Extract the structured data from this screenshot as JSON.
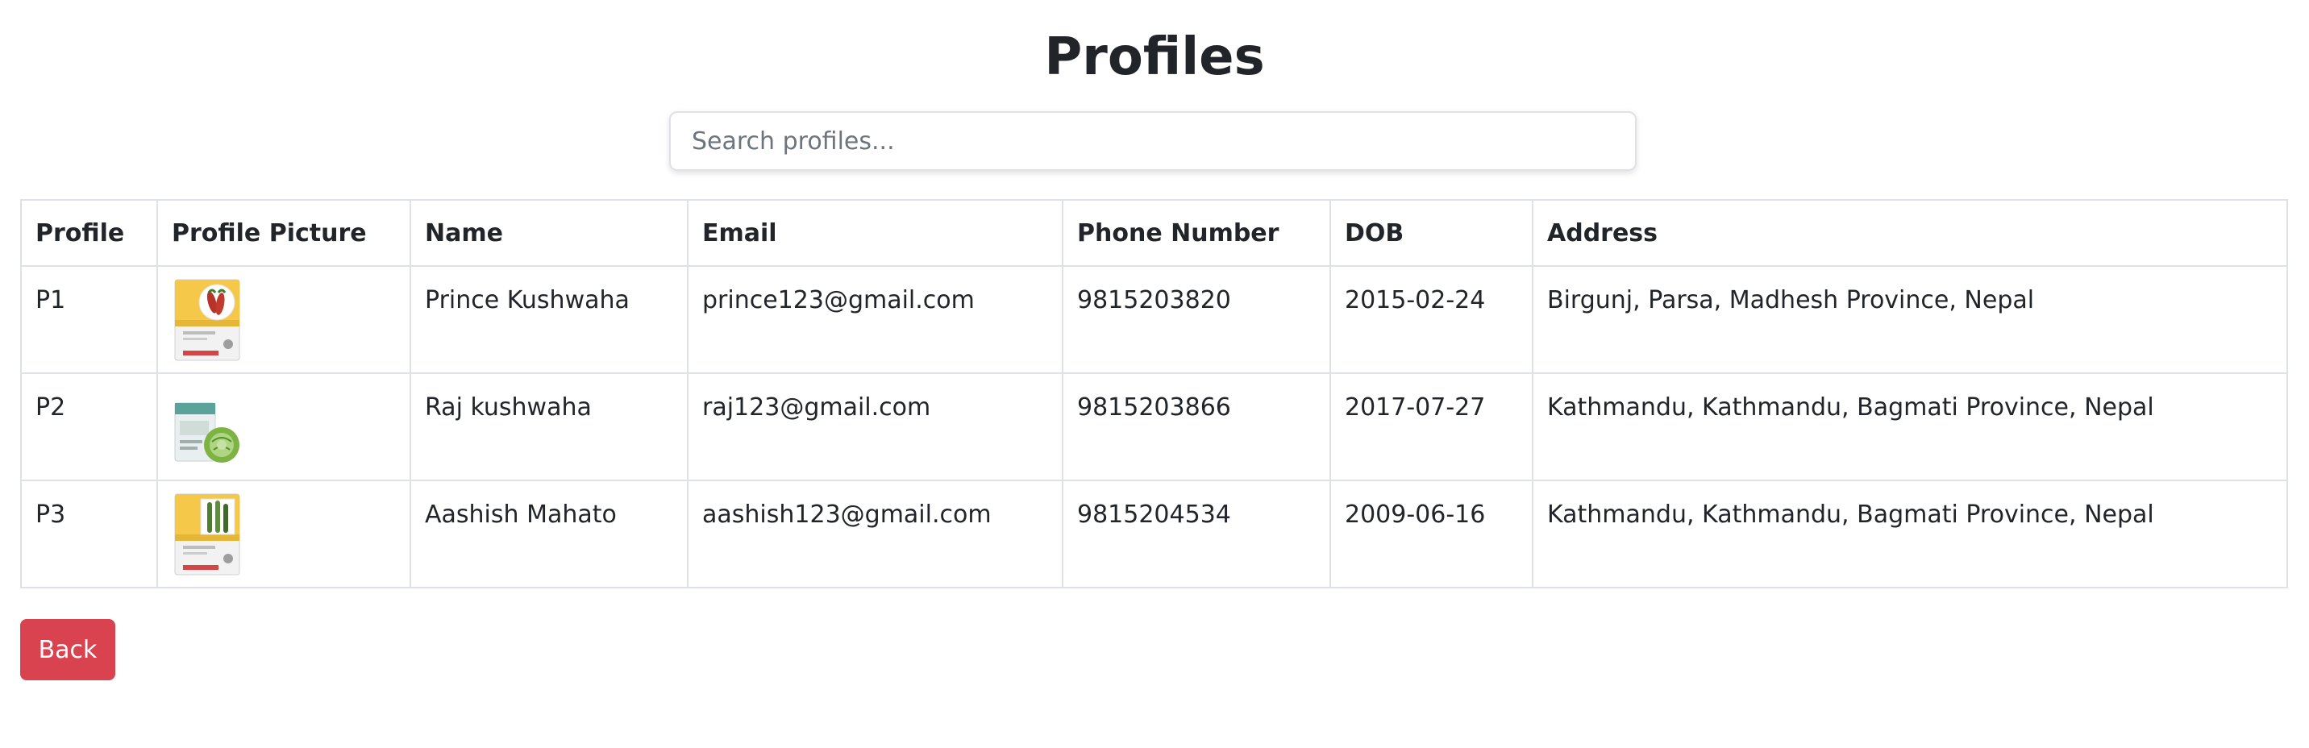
{
  "page": {
    "title": "Profiles"
  },
  "search": {
    "placeholder": "Search profiles..."
  },
  "table": {
    "headers": {
      "profile": "Profile",
      "picture": "Profile Picture",
      "name": "Name",
      "email": "Email",
      "phone": "Phone Number",
      "dob": "DOB",
      "address": "Address"
    },
    "rows": [
      {
        "profile": "P1",
        "picture_icon": "seed-packet-red-thumbnail",
        "name": "Prince Kushwaha",
        "email": "prince123@gmail.com",
        "phone": "9815203820",
        "dob": "2015-02-24",
        "address": "Birgunj, Parsa, Madhesh Province, Nepal"
      },
      {
        "profile": "P2",
        "picture_icon": "seed-packet-cabbage-thumbnail",
        "name": "Raj kushwaha",
        "email": "raj123@gmail.com",
        "phone": "9815203866",
        "dob": "2017-07-27",
        "address": "Kathmandu, Kathmandu, Bagmati Province, Nepal"
      },
      {
        "profile": "P3",
        "picture_icon": "seed-packet-green-thumbnail",
        "name": "Aashish Mahato",
        "email": "aashish123@gmail.com",
        "phone": "9815204534",
        "dob": "2009-06-16",
        "address": "Kathmandu, Kathmandu, Bagmati Province, Nepal"
      }
    ]
  },
  "actions": {
    "back_label": "Back"
  },
  "colors": {
    "back_button": "#d9434f",
    "border": "#dee2e6",
    "text": "#212529",
    "placeholder": "#6c757d"
  }
}
